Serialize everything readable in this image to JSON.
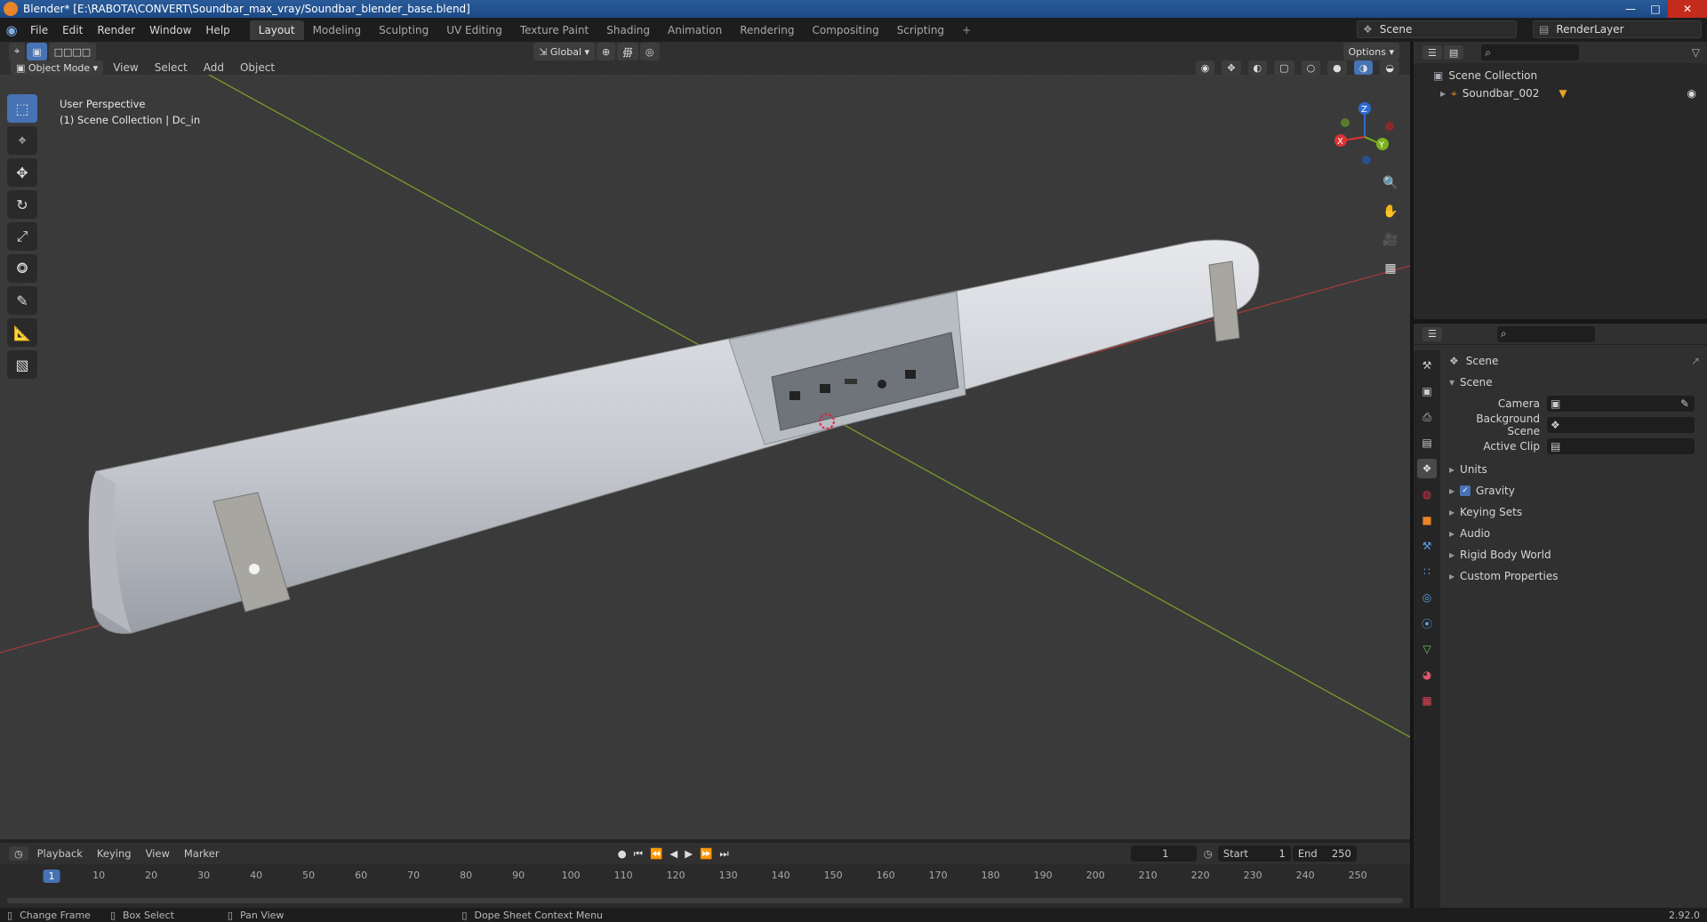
{
  "window_title": "Blender* [E:\\RABOTA\\CONVERT\\Soundbar_max_vray/Soundbar_blender_base.blend]",
  "menu": [
    "File",
    "Edit",
    "Render",
    "Window",
    "Help"
  ],
  "workspaces": [
    "Layout",
    "Modeling",
    "Sculpting",
    "UV Editing",
    "Texture Paint",
    "Shading",
    "Animation",
    "Rendering",
    "Compositing",
    "Scripting"
  ],
  "active_workspace": "Layout",
  "scene_name": "Scene",
  "render_layer": "RenderLayer",
  "viewport_header": {
    "transform_orientation": "Global",
    "options_label": "Options",
    "mode": "Object Mode",
    "menus": [
      "View",
      "Select",
      "Add",
      "Object"
    ]
  },
  "viewport_info": {
    "line1": "User Perspective",
    "line2": "(1) Scene Collection | Dc_in"
  },
  "gizmo": {
    "x": "X",
    "y": "Y",
    "z": "Z"
  },
  "outliner": {
    "root": "Scene Collection",
    "items": [
      {
        "label": "Soundbar_002",
        "visible": true
      }
    ]
  },
  "properties": {
    "context": "Scene",
    "panel": "Scene",
    "camera_label": "Camera",
    "background_scene_label": "Background Scene",
    "active_clip_label": "Active Clip",
    "subpanels": [
      "Units",
      "Gravity",
      "Keying Sets",
      "Audio",
      "Rigid Body World",
      "Custom Properties"
    ],
    "gravity_checked": true
  },
  "timeline": {
    "menus": [
      "Playback",
      "Keying",
      "View",
      "Marker"
    ],
    "current_frame": "1",
    "start_label": "Start",
    "start_value": "1",
    "end_label": "End",
    "end_value": "250",
    "ticks": [
      "1",
      "10",
      "20",
      "30",
      "40",
      "50",
      "60",
      "70",
      "80",
      "90",
      "100",
      "110",
      "120",
      "130",
      "140",
      "150",
      "160",
      "170",
      "180",
      "190",
      "200",
      "210",
      "220",
      "230",
      "240",
      "250"
    ]
  },
  "statusbar": {
    "items": [
      "Change Frame",
      "Box Select",
      "Pan View",
      "Dope Sheet Context Menu"
    ],
    "version": "2.92.0"
  },
  "colors": {
    "accent": "#4772b3",
    "viewport_bg": "#3a3a3a",
    "x_axis": "#a33a3a",
    "y_axis": "#7a9a2a",
    "model": "#c9ccd2"
  }
}
